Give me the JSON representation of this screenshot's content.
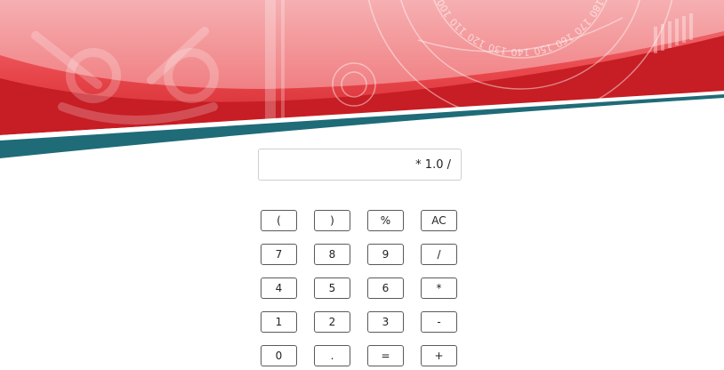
{
  "display": {
    "value": "* 1.0 /"
  },
  "banner": {
    "ruler_ticks": [
      "100",
      "110",
      "120",
      "130",
      "140",
      "150",
      "160",
      "170",
      "180"
    ]
  },
  "keypad": {
    "rows": [
      [
        "(",
        ")",
        "%",
        "AC"
      ],
      [
        "7",
        "8",
        "9",
        "/"
      ],
      [
        "4",
        "5",
        "6",
        "*"
      ],
      [
        "1",
        "2",
        "3",
        "-"
      ],
      [
        "0",
        ".",
        "=",
        "+"
      ]
    ]
  },
  "colors": {
    "banner_red": "#e3343a",
    "banner_dark_red": "#b3161d",
    "teal_stripe": "#1f6b78",
    "key_border": "#5a5a5a"
  }
}
